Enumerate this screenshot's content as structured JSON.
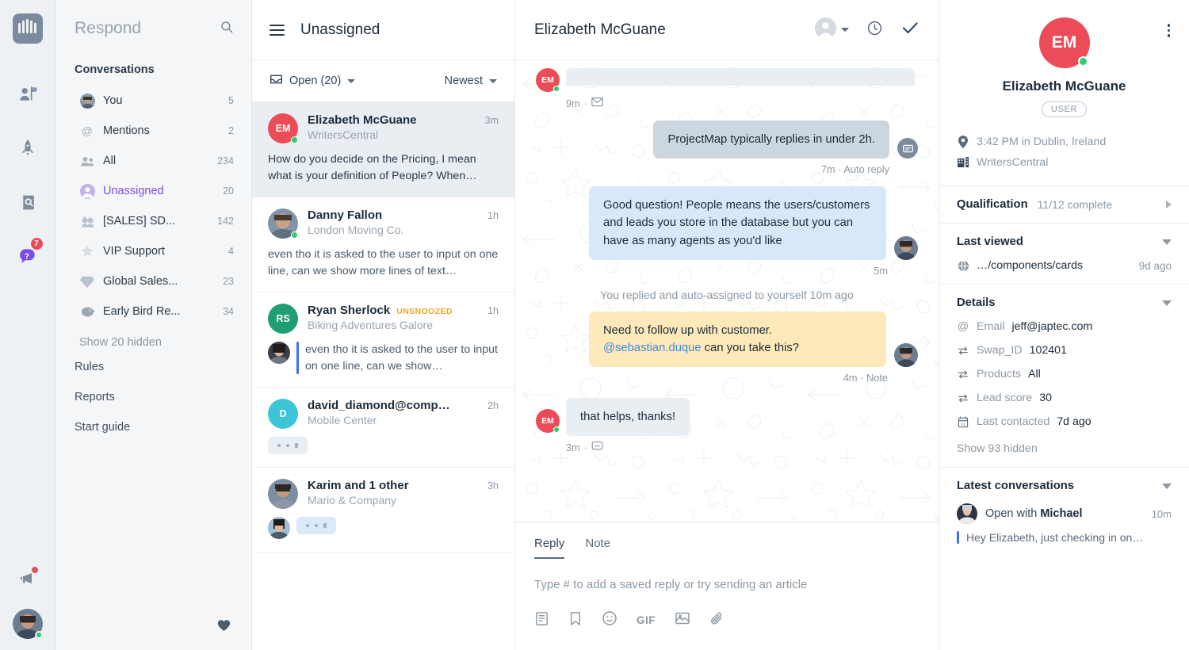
{
  "rail": {
    "logo_name": "intercom-logo",
    "icons": [
      {
        "name": "contacts-icon",
        "badge": ""
      },
      {
        "name": "outbound-rocket-icon",
        "badge": ""
      },
      {
        "name": "articles-search-icon",
        "badge": ""
      },
      {
        "name": "help-icon",
        "badge": "7"
      }
    ],
    "megaphone_name": "news-megaphone-icon"
  },
  "nav": {
    "title": "Respond",
    "search_icon": "search-icon",
    "section_label": "Conversations",
    "items": [
      {
        "label": "You",
        "count": "5",
        "icon": "avatar-you-icon",
        "active": false
      },
      {
        "label": "Mentions",
        "count": "2",
        "icon": "at-icon",
        "active": false
      },
      {
        "label": "All",
        "count": "234",
        "icon": "people-icon",
        "active": false
      },
      {
        "label": "Unassigned",
        "count": "20",
        "icon": "unassigned-avatar-icon",
        "active": true
      },
      {
        "label": "[SALES] SD...",
        "count": "142",
        "icon": "emoji-icon",
        "active": false
      },
      {
        "label": "VIP Support",
        "count": "4",
        "icon": "emoji-icon",
        "active": false
      },
      {
        "label": "Global Sales...",
        "count": "23",
        "icon": "emoji-icon",
        "active": false
      },
      {
        "label": "Early Bird Re...",
        "count": "34",
        "icon": "emoji-icon",
        "active": false
      }
    ],
    "show_hidden": "Show 20 hidden",
    "links": [
      "Rules",
      "Reports",
      "Start guide"
    ],
    "heart_icon": "heart-icon"
  },
  "list": {
    "menu_icon": "hamburger-menu-icon",
    "title": "Unassigned",
    "filter_left": "Open (20)",
    "filter_left_icon": "inbox-icon",
    "filter_right": "Newest",
    "conversations": [
      {
        "name": "Elizabeth McGuane",
        "org": "WritersCentral",
        "time": "3m",
        "badge": "",
        "preview": "How do you decide on the Pricing, I mean what is your definition of People? When…",
        "avatar_type": "initials",
        "initials": "EM",
        "avatar_color": "#ec4c57",
        "online": true,
        "selected": true,
        "typing": false,
        "quoted": false
      },
      {
        "name": "Danny Fallon",
        "org": "London Moving Co.",
        "time": "1h",
        "badge": "",
        "preview": "even tho it is asked to the user to input on one line, can we show more lines of text…",
        "avatar_type": "photo",
        "avatar_color": "#6c7e91",
        "online": true,
        "selected": false,
        "typing": false,
        "quoted": false
      },
      {
        "name": "Ryan Sherlock",
        "org": "Biking Adventures Galore",
        "time": "1h",
        "badge": "UNSNOOZED",
        "preview": "even tho it is asked to the user to input on one line, can we show…",
        "avatar_type": "initials",
        "initials": "RS",
        "avatar_color": "#1e9e72",
        "online": false,
        "selected": false,
        "typing": false,
        "quoted": true
      },
      {
        "name": "david_diamond@comp…",
        "org": "Mobile Center",
        "time": "2h",
        "badge": "",
        "preview": "",
        "avatar_type": "initials",
        "initials": "D",
        "avatar_color": "#3cc5d6",
        "online": false,
        "selected": false,
        "typing": true,
        "typing_style": "gray",
        "quoted": false
      },
      {
        "name": "Karim and 1 other",
        "org": "Mario & Company",
        "time": "3h",
        "badge": "",
        "preview": "",
        "avatar_type": "photo",
        "avatar_color": "#7a8ea1",
        "online": false,
        "selected": false,
        "typing": true,
        "typing_style": "blue",
        "quoted": false
      }
    ]
  },
  "conversation": {
    "title": "Elizabeth McGuane",
    "actions": [
      {
        "name": "assignee-selector",
        "icon": "person-avatar-icon"
      },
      {
        "name": "snooze-button",
        "icon": "clock-icon"
      },
      {
        "name": "close-conversation-button",
        "icon": "check-icon"
      }
    ],
    "messages": [
      {
        "id": "clipped",
        "side": "in",
        "kind": "clipped",
        "text": "",
        "stamp": "9m",
        "stamp_icon": "envelope-icon",
        "avatar_initials": "EM"
      },
      {
        "id": "auto-reply",
        "side": "out",
        "kind": "auto",
        "text": "ProjectMap typically replies in under 2h.",
        "stamp": "7m · Auto reply",
        "avatar_kind": "bot"
      },
      {
        "id": "agent-reply",
        "side": "out",
        "kind": "blue",
        "text": "Good question! People means the users/customers and leads you store in the database but you can have as many agents as you'd like",
        "stamp": "5m",
        "avatar_kind": "photo"
      },
      {
        "id": "system",
        "side": "center",
        "kind": "system",
        "text": "You replied and auto-assigned to yourself 10m ago"
      },
      {
        "id": "note",
        "side": "out",
        "kind": "note",
        "text_before": "Need to follow up with customer. ",
        "mention": "@sebastian.duque",
        "text_after": " can you take this?",
        "stamp": "4m ·  Note",
        "avatar_kind": "photo"
      },
      {
        "id": "customer-thanks",
        "side": "in",
        "kind": "gray",
        "text": "that helps, thanks!",
        "stamp": "3m",
        "stamp_icon": "chat-icon",
        "avatar_initials": "EM"
      }
    ]
  },
  "composer": {
    "tabs": [
      {
        "label": "Reply",
        "active": true
      },
      {
        "label": "Note",
        "active": false
      }
    ],
    "placeholder": "Type # to add a saved reply or try sending an article",
    "icons": [
      {
        "name": "article-icon",
        "label": ""
      },
      {
        "name": "saved-reply-bookmark-icon",
        "label": ""
      },
      {
        "name": "emoji-icon",
        "label": ""
      },
      {
        "name": "gif-icon",
        "label": "GIF"
      },
      {
        "name": "image-icon",
        "label": ""
      },
      {
        "name": "attachment-icon",
        "label": ""
      }
    ]
  },
  "side": {
    "kebab_name": "more-options-icon",
    "avatar_initials": "EM",
    "avatar_color": "#ec4c57",
    "name": "Elizabeth McGuane",
    "tag": "USER",
    "facts": [
      {
        "icon": "location-pin-icon",
        "text": "3:42 PM in Dublin, Ireland"
      },
      {
        "icon": "company-building-icon",
        "text": "WritersCentral"
      }
    ],
    "qualification": {
      "title": "Qualification",
      "subtitle": "11/12 complete"
    },
    "last_viewed": {
      "title": "Last viewed",
      "rows": [
        {
          "icon": "globe-icon",
          "label": "…/components/cards",
          "time": "9d ago"
        }
      ]
    },
    "details": {
      "title": "Details",
      "rows": [
        {
          "icon": "at-icon",
          "key": "Email",
          "value": "jeff@japtec.com"
        },
        {
          "icon": "swap-icon",
          "key": "Swap_ID",
          "value": "102401"
        },
        {
          "icon": "swap-icon",
          "key": "Products",
          "value": "All"
        },
        {
          "icon": "swap-icon",
          "key": "Lead score",
          "value": "30"
        },
        {
          "icon": "calendar-icon",
          "key": "Last contacted",
          "value": "7d ago"
        }
      ],
      "show_more": "Show 93 hidden"
    },
    "latest_conversations": {
      "title": "Latest conversations",
      "items": [
        {
          "prefix": "Open with ",
          "who": "Michael",
          "time": "10m",
          "preview": "Hey Elizabeth, just checking in on…"
        }
      ]
    }
  },
  "colors": {
    "accent_purple": "#7d4ce0",
    "avatar_red": "#ec4c57",
    "note_yellow": "#fde9b9",
    "bubble_blue": "#d7e8fb",
    "bubble_gray": "#e9eef3",
    "badge_orange": "#f5a623",
    "online_green": "#2ecc71"
  }
}
